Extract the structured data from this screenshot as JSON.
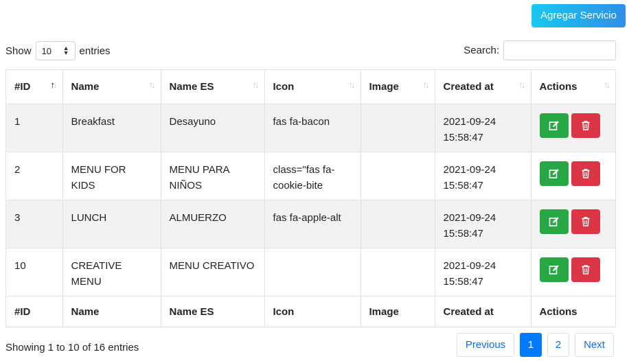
{
  "toolbar": {
    "add_label": "Agregar Servicio"
  },
  "length": {
    "show_label": "Show",
    "value": "10",
    "entries_label": "entries"
  },
  "search": {
    "label": "Search:",
    "value": "",
    "placeholder": ""
  },
  "table": {
    "headers": [
      "#ID",
      "Name",
      "Name ES",
      "Icon",
      "Image",
      "Created at",
      "Actions"
    ],
    "rows": [
      {
        "id": "1",
        "name": "Breakfast",
        "name_es": "Desayuno",
        "icon": "fas fa-bacon",
        "image": "",
        "created": "2021-09-24 15:58:47"
      },
      {
        "id": "2",
        "name": "MENU FOR KIDS",
        "name_es": "MENU PARA NIÑOS",
        "icon": "class=\"fas fa-cookie-bite",
        "image": "",
        "created": "2021-09-24 15:58:47"
      },
      {
        "id": "3",
        "name": "LUNCH",
        "name_es": "ALMUERZO",
        "icon": "fas fa-apple-alt",
        "image": "",
        "created": "2021-09-24 15:58:47"
      },
      {
        "id": "10",
        "name": "CREATIVE MENU",
        "name_es": "MENU CREATIVO",
        "icon": "",
        "image": "",
        "created": "2021-09-24 15:58:47"
      }
    ]
  },
  "info": "Showing 1 to 10 of 16 entries",
  "pagination": {
    "previous": "Previous",
    "pages": [
      "1",
      "2"
    ],
    "next": "Next",
    "active_page": "1"
  },
  "colors": {
    "accent": "#007bff",
    "edit": "#28a745",
    "delete": "#dc3545"
  }
}
